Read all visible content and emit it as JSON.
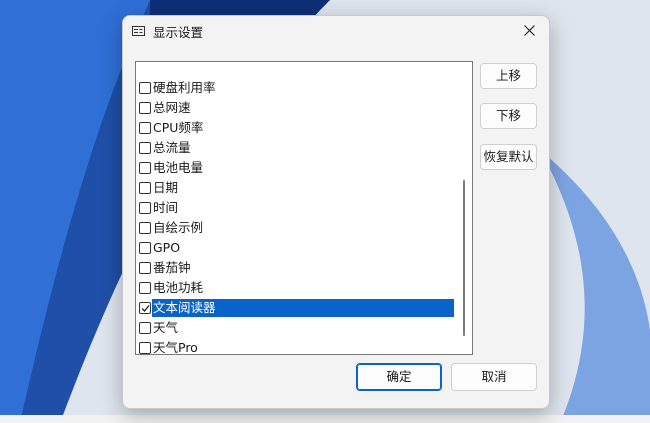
{
  "dialog": {
    "title": "显示设置",
    "items": [
      {
        "label": "硬盘利用率",
        "checked": false,
        "selected": false
      },
      {
        "label": "总网速",
        "checked": false,
        "selected": false
      },
      {
        "label": "CPU频率",
        "checked": false,
        "selected": false
      },
      {
        "label": "总流量",
        "checked": false,
        "selected": false
      },
      {
        "label": "电池电量",
        "checked": false,
        "selected": false
      },
      {
        "label": "日期",
        "checked": false,
        "selected": false
      },
      {
        "label": "时间",
        "checked": false,
        "selected": false
      },
      {
        "label": "自绘示例",
        "checked": false,
        "selected": false
      },
      {
        "label": "GPO",
        "checked": false,
        "selected": false
      },
      {
        "label": "番茄钟",
        "checked": false,
        "selected": false
      },
      {
        "label": "电池功耗",
        "checked": false,
        "selected": false
      },
      {
        "label": "文本阅读器",
        "checked": true,
        "selected": true
      },
      {
        "label": "天气",
        "checked": false,
        "selected": false
      },
      {
        "label": "天气Pro",
        "checked": false,
        "selected": false
      }
    ],
    "buttons": {
      "move_up": "上移",
      "move_down": "下移",
      "restore_default": "恢复默认",
      "ok": "确定",
      "cancel": "取消"
    },
    "colors": {
      "selection": "#0a63c9",
      "accent": "#0a63c9"
    }
  }
}
